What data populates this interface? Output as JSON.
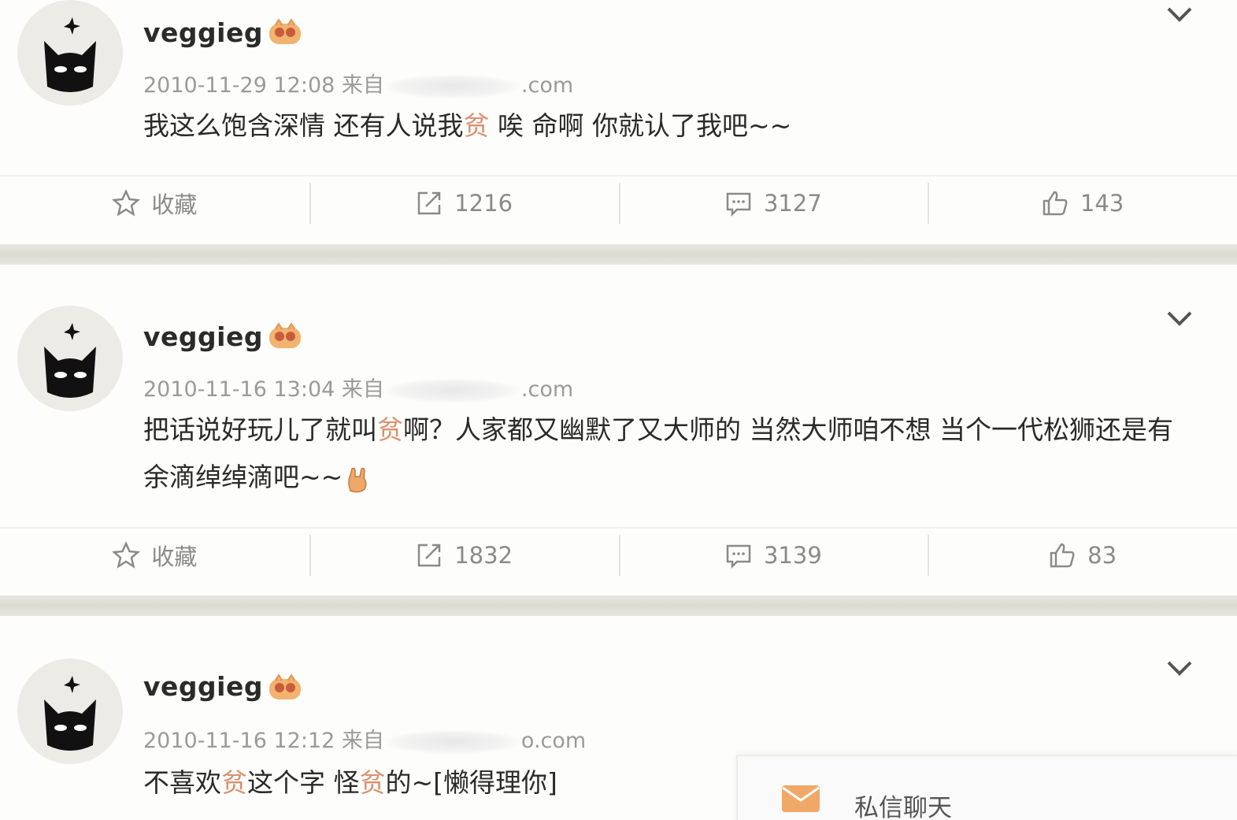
{
  "posts": [
    {
      "username": "veggieg",
      "timestamp": "2010-11-29 12:08",
      "source_prefix": "来自",
      "source_suffix": ".com",
      "content_parts": [
        "我这么饱含深情 还有人说我",
        "贫",
        " 唉 命啊 你就认了我吧~~"
      ],
      "actions": {
        "favorite": "收藏",
        "repost": "1216",
        "comment": "3127",
        "like": "143"
      }
    },
    {
      "username": "veggieg",
      "timestamp": "2010-11-16 13:04",
      "source_prefix": "来自",
      "source_suffix": ".com",
      "content_parts": [
        "把话说好玩儿了就叫",
        "贫",
        "啊？人家都又幽默了又大师的 当然大师咱不想 当个一代松狮还是有余滴绰绰滴吧~~"
      ],
      "actions": {
        "favorite": "收藏",
        "repost": "1832",
        "comment": "3139",
        "like": "83"
      }
    },
    {
      "username": "veggieg",
      "timestamp": "2010-11-16 12:12",
      "source_prefix": "来自",
      "source_suffix": "o.com",
      "content_parts": [
        "不喜欢",
        "贫",
        "这个字 怪",
        "贫",
        "的~[懒得理你]"
      ]
    }
  ],
  "dm": {
    "label": "私信聊天"
  },
  "icons": {
    "avatar": "black-cat-avatar",
    "badge": "vip-badge-icon",
    "favorite": "star-icon",
    "repost": "repost-icon",
    "comment": "comment-icon",
    "like": "thumbs-up-icon",
    "menu": "chevron-down-icon",
    "dm": "envelope-icon"
  },
  "colors": {
    "highlight": "#d9916e",
    "meta": "#9a9a9a",
    "separator": "#dcdbd3"
  }
}
